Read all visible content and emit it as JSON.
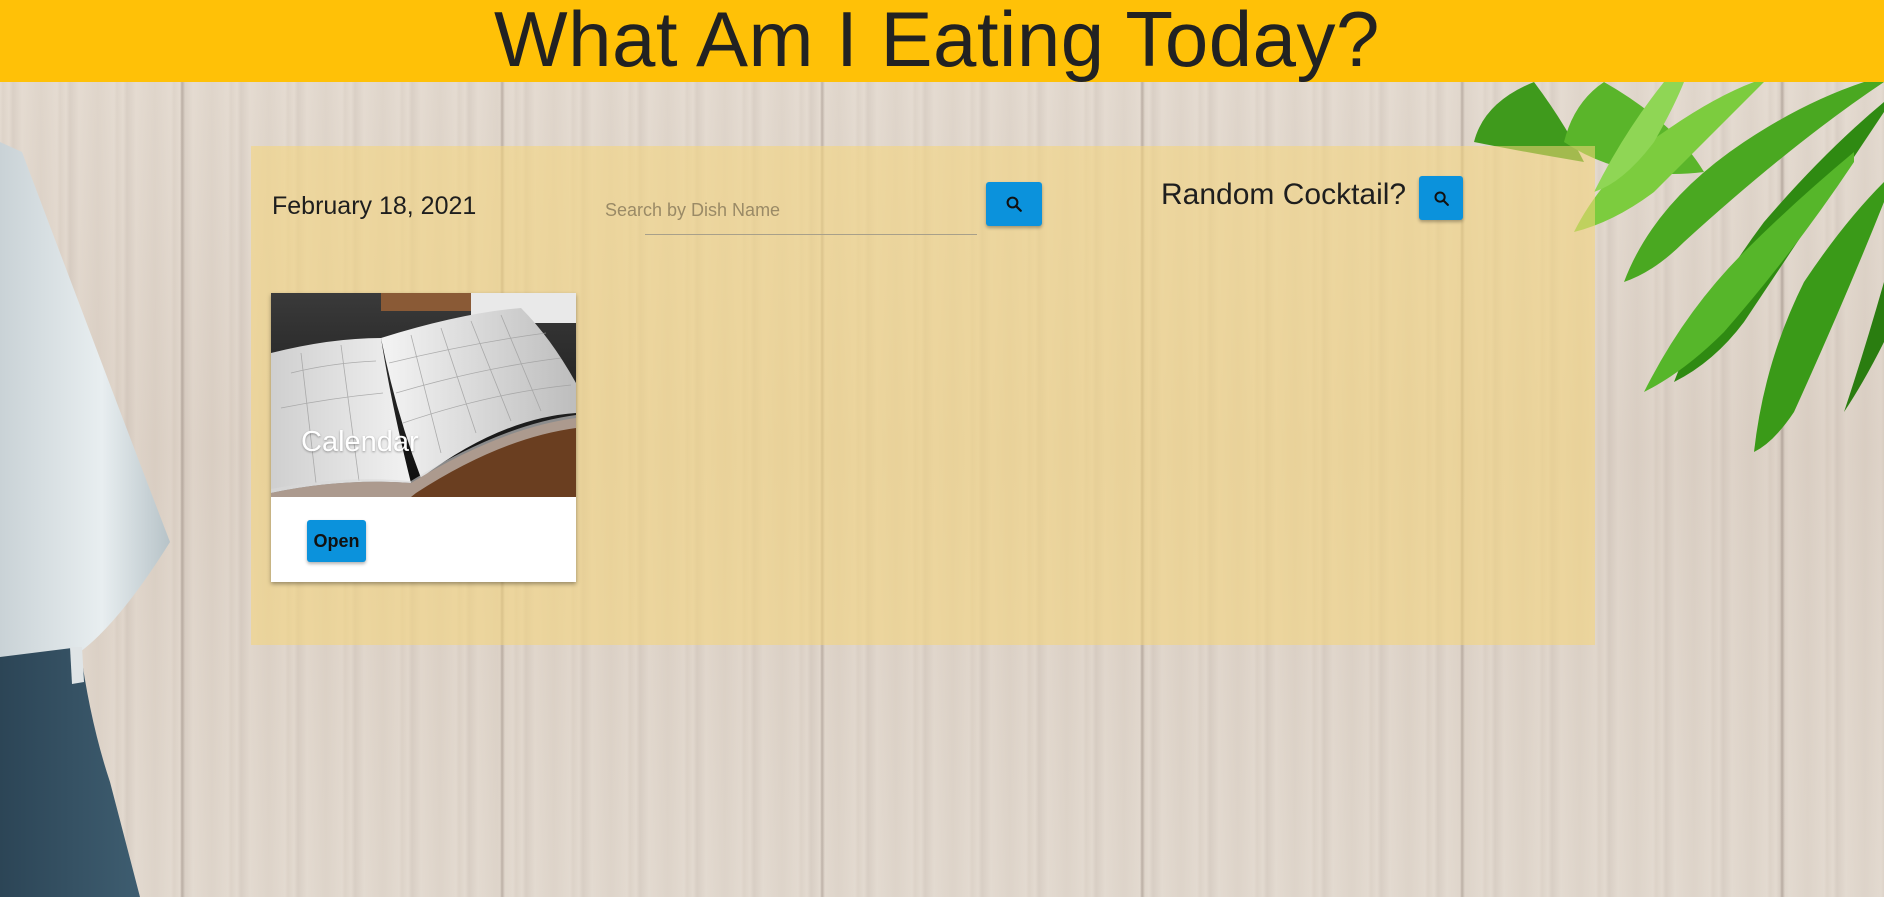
{
  "header": {
    "title": "What Am I Eating Today?",
    "background_color": "#ffc107"
  },
  "main": {
    "date": "February 18, 2021",
    "search": {
      "placeholder": "Search by Dish Name",
      "value": "",
      "button_icon": "search-icon"
    },
    "random_cocktail": {
      "label": "Random Cocktail?",
      "button_icon": "search-icon"
    },
    "cards": [
      {
        "title": "Calendar",
        "image": "open-planner-calendar-photo",
        "action_label": "Open"
      }
    ]
  },
  "background": {
    "decorations": [
      "wood-grain-texture",
      "knife",
      "green-leaves"
    ]
  },
  "colors": {
    "accent": "#0b92dc",
    "panel_overlay": "#f6d678"
  }
}
